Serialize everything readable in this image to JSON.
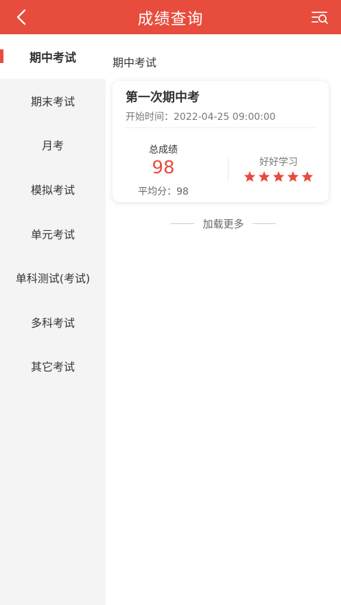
{
  "header": {
    "title": "成绩查询",
    "accent_color": "#e84c3d",
    "back_icon": "chevron-left-icon",
    "filter_icon": "filter-search-icon"
  },
  "sidebar": {
    "items": [
      {
        "label": "期中考试",
        "active": true
      },
      {
        "label": "期末考试",
        "active": false
      },
      {
        "label": "月考",
        "active": false
      },
      {
        "label": "模拟考试",
        "active": false
      },
      {
        "label": "单元考试",
        "active": false
      },
      {
        "label": "单科测试(考试)",
        "active": false
      },
      {
        "label": "多科考试",
        "active": false
      },
      {
        "label": "其它考试",
        "active": false
      }
    ]
  },
  "main": {
    "section_title": "期中考试",
    "card": {
      "title": "第一次期中考",
      "time_label": "开始时间：",
      "time_value": "2022-04-25 09:00:00",
      "score_label": "总成绩",
      "score_value": "98",
      "avg_label": "平均分：",
      "avg_value": "98",
      "comment": "好好学习",
      "stars": 5,
      "star_color": "#e84c3d"
    },
    "load_more": "加载更多"
  }
}
